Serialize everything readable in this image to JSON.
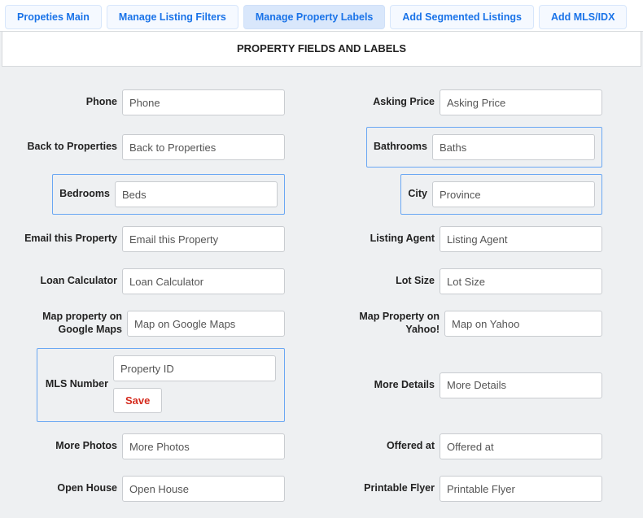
{
  "tabs": {
    "items": [
      {
        "label": "Propeties Main",
        "active": false
      },
      {
        "label": "Manage Listing Filters",
        "active": false
      },
      {
        "label": "Manage Property Labels",
        "active": true
      },
      {
        "label": "Add Segmented Listings",
        "active": false
      },
      {
        "label": "Add MLS/IDX",
        "active": false
      }
    ]
  },
  "panel": {
    "title": "PROPERTY FIELDS AND LABELS"
  },
  "fields": {
    "phone": {
      "label": "Phone",
      "value": "Phone"
    },
    "asking_price": {
      "label": "Asking Price",
      "value": "Asking Price"
    },
    "back_to_properties": {
      "label": "Back to Properties",
      "value": "Back to Properties"
    },
    "bathrooms": {
      "label": "Bathrooms",
      "value": "Baths"
    },
    "bedrooms": {
      "label": "Bedrooms",
      "value": "Beds"
    },
    "city": {
      "label": "City",
      "value": "Province"
    },
    "email_property": {
      "label": "Email this Property",
      "value": "Email this Property"
    },
    "listing_agent": {
      "label": "Listing Agent",
      "value": "Listing Agent"
    },
    "loan_calculator": {
      "label": "Loan Calculator",
      "value": "Loan Calculator"
    },
    "lot_size": {
      "label": "Lot Size",
      "value": "Lot Size"
    },
    "map_google": {
      "label": "Map property on Google Maps",
      "value": "Map on Google Maps"
    },
    "map_yahoo": {
      "label": "Map Property on Yahoo!",
      "value": "Map on Yahoo"
    },
    "mls_number": {
      "label": "MLS Number",
      "value": "Property ID",
      "save": "Save"
    },
    "more_details": {
      "label": "More Details",
      "value": "More Details"
    },
    "more_photos": {
      "label": "More Photos",
      "value": "More Photos"
    },
    "offered_at": {
      "label": "Offered at",
      "value": "Offered at"
    },
    "open_house": {
      "label": "Open House",
      "value": "Open House"
    },
    "printable_flyer": {
      "label": "Printable Flyer",
      "value": "Printable Flyer"
    }
  }
}
